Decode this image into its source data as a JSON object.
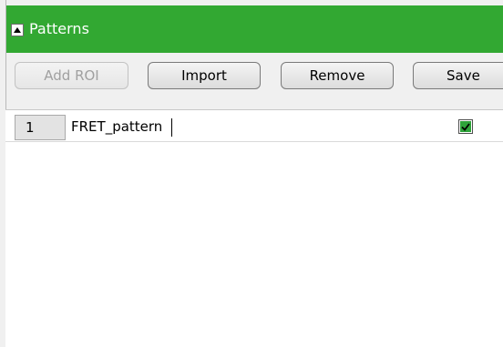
{
  "panel": {
    "title": "Patterns",
    "accent_color": "#32a832",
    "collapse_icon": "triangle-up-icon"
  },
  "toolbar": {
    "add_label": "Add ROI",
    "import_label": "Import",
    "remove_label": "Remove",
    "save_label": "Save"
  },
  "patterns": [
    {
      "index": "1",
      "name": "FRET_pattern",
      "checked": true
    }
  ]
}
